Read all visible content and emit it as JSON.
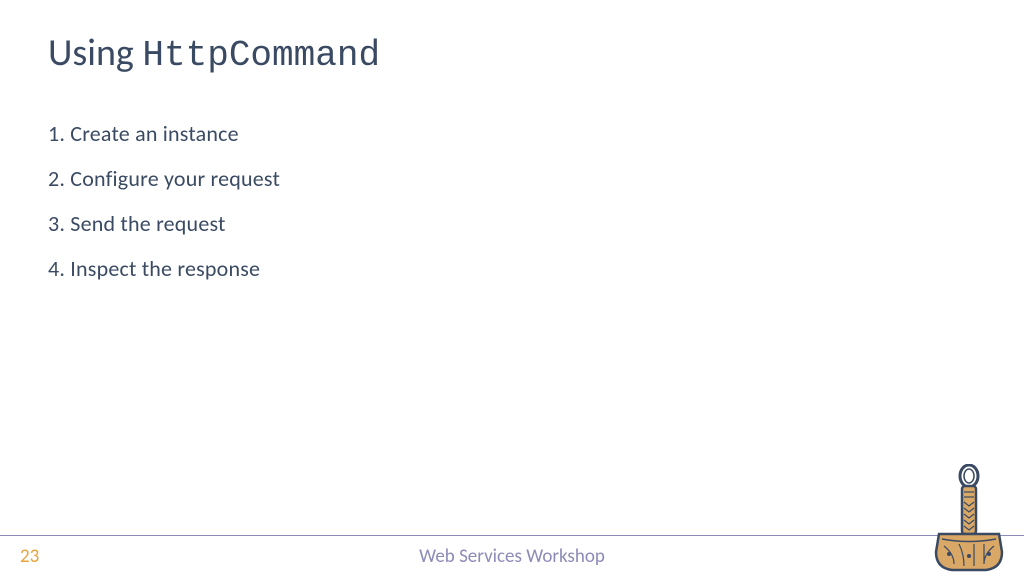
{
  "title": {
    "prefix": "Using ",
    "command": "HttpCommand"
  },
  "steps": [
    "1. Create an instance",
    "2. Configure your request",
    "3. Send the request",
    "4. Inspect the response"
  ],
  "footer": {
    "page_number": "23",
    "title": "Web Services Workshop"
  }
}
